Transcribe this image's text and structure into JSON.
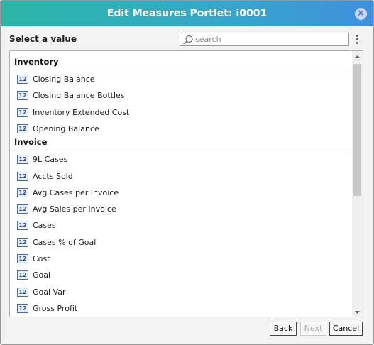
{
  "dialog": {
    "title": "Edit Measures Portlet: i0001",
    "close_glyph": "✕",
    "select_label": "Select a value",
    "search_placeholder": "search",
    "icon_text": "12"
  },
  "groups": [
    {
      "name": "Inventory",
      "items": [
        "Closing Balance",
        "Closing Balance Bottles",
        "Inventory Extended Cost",
        "Opening Balance"
      ]
    },
    {
      "name": "Invoice",
      "items": [
        "9L Cases",
        "Accts Sold",
        "Avg Cases per Invoice",
        "Avg Sales per Invoice",
        "Cases",
        "Cases % of Goal",
        "Cost",
        "Goal",
        "Goal Var",
        "Gross Profit"
      ]
    }
  ],
  "buttons": {
    "back": "Back",
    "next": "Next",
    "cancel": "Cancel"
  },
  "colors": {
    "title_gradient_start": "#2bb7a6",
    "title_gradient_end": "#3f90dc"
  }
}
